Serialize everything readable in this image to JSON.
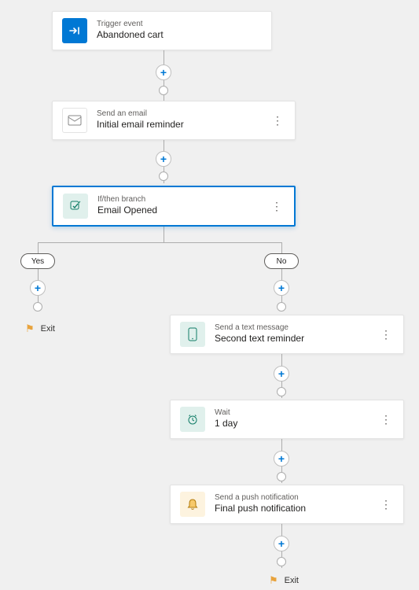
{
  "trigger": {
    "subtitle": "Trigger event",
    "title": "Abandoned cart"
  },
  "email": {
    "subtitle": "Send an email",
    "title": "Initial email reminder"
  },
  "branch": {
    "subtitle": "If/then branch",
    "title": "Email Opened"
  },
  "branch_labels": {
    "yes": "Yes",
    "no": "No"
  },
  "sms": {
    "subtitle": "Send a text message",
    "title": "Second text reminder"
  },
  "wait": {
    "subtitle": "Wait",
    "title": "1 day"
  },
  "push": {
    "subtitle": "Send a push notification",
    "title": "Final push notification"
  },
  "exit_left": "Exit",
  "exit_right": "Exit",
  "icons": {
    "trigger": "trigger-icon",
    "email": "email-icon",
    "branch": "branch-icon",
    "sms": "sms-icon",
    "wait": "wait-icon",
    "push": "push-icon"
  }
}
